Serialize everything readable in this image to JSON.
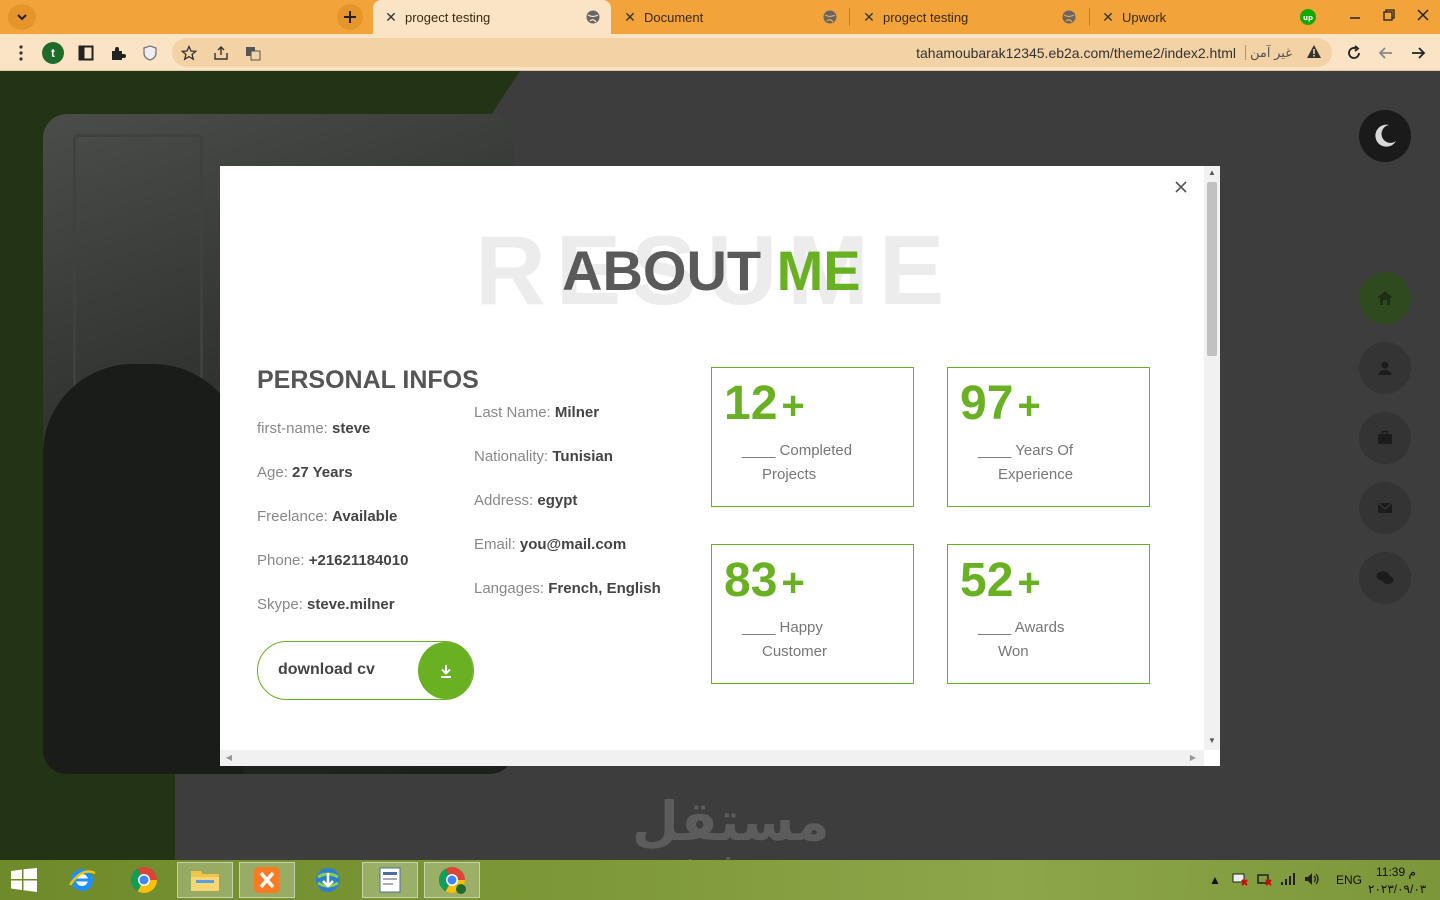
{
  "browser": {
    "tabs": [
      {
        "title": "progect testing",
        "active": true
      },
      {
        "title": "Document",
        "active": false
      },
      {
        "title": "progect testing",
        "active": false
      },
      {
        "title": "Upwork",
        "active": false
      }
    ],
    "url": "tahamoubarak12345.eb2a.com/theme2/index2.html",
    "insecure_label": "غير آمن",
    "profile_initial": "t"
  },
  "modal": {
    "background_word": "RESUME",
    "heading_part1": "ABOUT",
    "heading_part2": "ME",
    "section_title": "PERSONAL INFOS",
    "left_infos": [
      {
        "label": "first-name:",
        "value": "steve"
      },
      {
        "label": "Age:",
        "value": "27 Years"
      },
      {
        "label": "Freelance:",
        "value": "Available"
      },
      {
        "label": "Phone:",
        "value": "+21621184010"
      },
      {
        "label": "Skype:",
        "value": "steve.milner"
      }
    ],
    "right_infos": [
      {
        "label": "Last Name:",
        "value": "Milner"
      },
      {
        "label": "Nationality:",
        "value": "Tunisian"
      },
      {
        "label": "Address:",
        "value": "egypt"
      },
      {
        "label": "Email:",
        "value": "you@mail.com"
      },
      {
        "label": "Langages:",
        "value": "French, English"
      }
    ],
    "download_label": "download cv",
    "stats": [
      {
        "number": "12",
        "plus": "+",
        "line1": "____ Completed",
        "line2": "Projects"
      },
      {
        "number": "97",
        "plus": "+",
        "line1": "____ Years Of",
        "line2": "Experience"
      },
      {
        "number": "83",
        "plus": "+",
        "line1": "____ Happy",
        "line2": "Customer"
      },
      {
        "number": "52",
        "plus": "+",
        "line1": "____ Awards",
        "line2": "Won"
      }
    ]
  },
  "watermark": {
    "arabic": "مستقل",
    "latin": "mostaql.com"
  },
  "taskbar": {
    "language": "ENG",
    "time": "11:39 م",
    "date": "٢٠٢٣/٠٩/٠٣"
  },
  "colors": {
    "accent": "#6ab023",
    "tab_strip": "#f2a33a",
    "toolbar": "#fbe3c6"
  }
}
